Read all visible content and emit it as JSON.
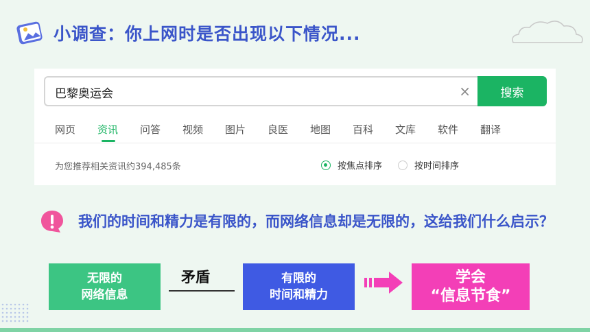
{
  "header": {
    "title": "小调查：你上网时是否出现以下情况..."
  },
  "search": {
    "query": "巴黎奥运会",
    "button_label": "搜索",
    "clear_symbol": "×"
  },
  "tabs": [
    {
      "label": "网页",
      "active": false
    },
    {
      "label": "资讯",
      "active": true
    },
    {
      "label": "问答",
      "active": false
    },
    {
      "label": "视频",
      "active": false
    },
    {
      "label": "图片",
      "active": false
    },
    {
      "label": "良医",
      "active": false
    },
    {
      "label": "地图",
      "active": false
    },
    {
      "label": "百科",
      "active": false
    },
    {
      "label": "文库",
      "active": false
    },
    {
      "label": "软件",
      "active": false
    },
    {
      "label": "翻译",
      "active": false
    }
  ],
  "results": {
    "count_text": "为您推荐相关资讯约394,485条",
    "sort_focus": "按焦点排序",
    "sort_time": "按时间排序"
  },
  "question": {
    "text": "我们的时间和精力是有限的，而网络信息却是无限的，这给我们什么启示？"
  },
  "flow": {
    "unlimited_line1": "无限的",
    "unlimited_line2": "网络信息",
    "conflict": "矛盾",
    "limited_line1": "有限的",
    "limited_line2": "时间和精力",
    "learn_line1": "学会",
    "learn_line2": "“信息节食”"
  },
  "colors": {
    "title_blue": "#3a55c9",
    "search_green": "#1bb463",
    "box_green": "#3cc583",
    "box_blue": "#3f5ae3",
    "box_pink": "#f33fb7"
  }
}
